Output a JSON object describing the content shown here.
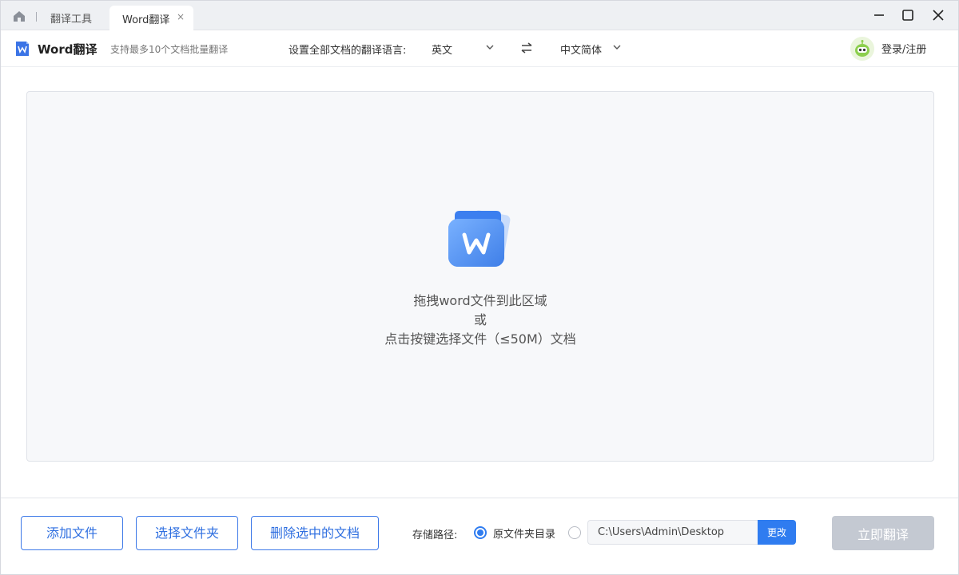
{
  "titlebar": {
    "tab_tools": "翻译工具",
    "tab_active": "Word翻译",
    "tab_close": "×"
  },
  "header": {
    "app_title": "Word翻译",
    "app_subtitle": "支持最多10个文档批量翻译",
    "lang_label": "设置全部文档的翻译语言:",
    "source_lang": "英文",
    "target_lang": "中文简体",
    "login": "登录/注册"
  },
  "dropzone": {
    "line1": "拖拽word文件到此区域",
    "line2": "或",
    "line3": "点击按键选择文件（≤50M）文档",
    "icon_letter": "W"
  },
  "footer": {
    "add_file": "添加文件",
    "select_folder": "选择文件夹",
    "delete_selected": "删除选中的文档",
    "save_path_label": "存储路径:",
    "option_original": "原文件夹目录",
    "custom_path": "C:\\Users\\Admin\\Desktop",
    "change": "更改",
    "translate_now": "立即翻译"
  },
  "colors": {
    "accent": "#2f7cf0",
    "disabled_button": "#c4c9d2",
    "dropzone_bg": "#f7f8fa"
  }
}
